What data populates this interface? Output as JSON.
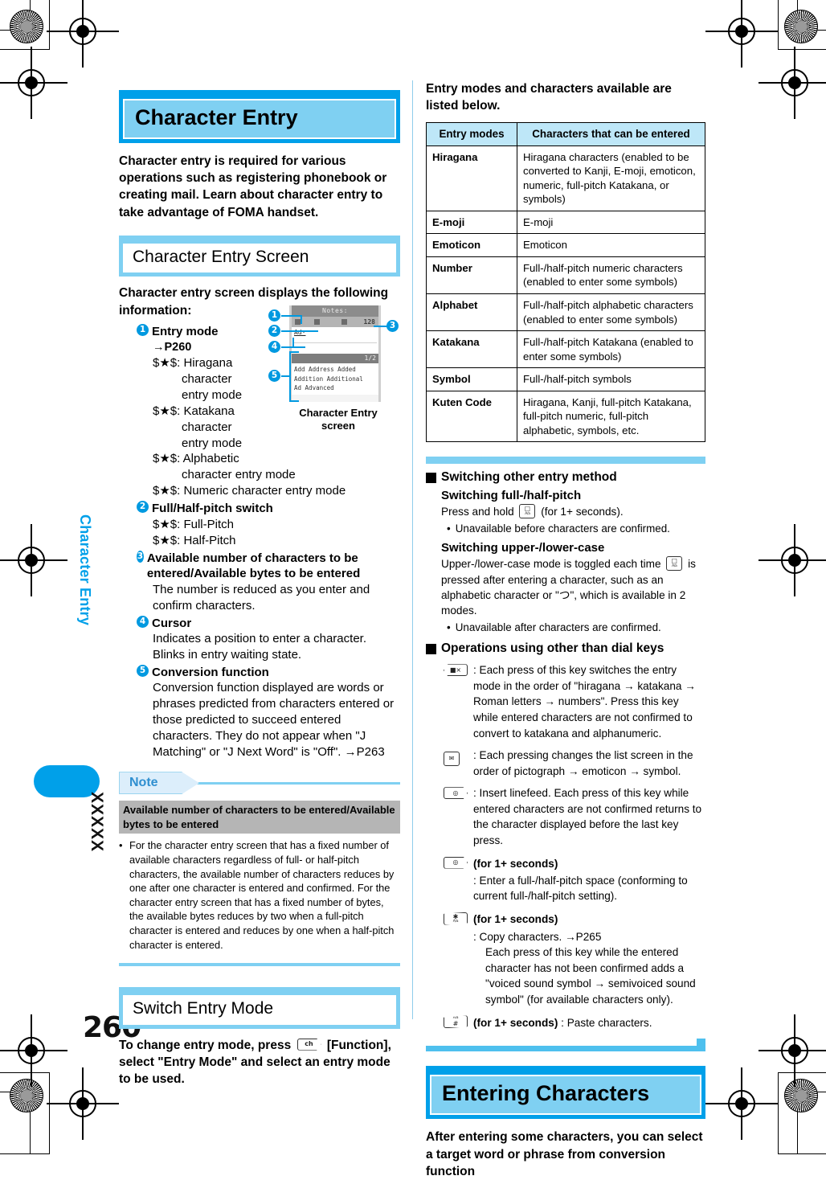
{
  "page": {
    "number": "260",
    "sidebar_label": "Character Entry",
    "sidebar_code": "XXXXX"
  },
  "left": {
    "chapter_title": "Character Entry",
    "lead": "Character entry is required for various operations such as registering phonebook or creating mail. Learn about character entry to take advantage of FOMA handset.",
    "section1_title": "Character Entry Screen",
    "section1_intro": "Character entry screen displays the following information:",
    "items": [
      {
        "num": "1",
        "title": "Entry mode",
        "ref": "→P260",
        "lines": [
          "$★$: Hiragana",
          "character",
          "entry mode",
          "$★$: Katakana",
          "character",
          "entry mode",
          "$★$: Alphabetic",
          "character entry mode",
          "$★$: Numeric character entry mode"
        ]
      },
      {
        "num": "2",
        "title": "Full/Half-pitch switch",
        "lines": [
          "$★$: Full-Pitch",
          "$★$: Half-Pitch"
        ]
      },
      {
        "num": "3",
        "title": "Available number of characters to be entered/Available bytes to be entered",
        "body": "The number is reduced as you enter and confirm characters."
      },
      {
        "num": "4",
        "title": "Cursor",
        "body": "Indicates a position to enter a character. Blinks in entry waiting state."
      },
      {
        "num": "5",
        "title": "Conversion function",
        "body": "Conversion function displayed are words or phrases predicted from characters entered or those predicted to succeed entered characters. They do not appear when \"J Matching\" or \"J Next Word\" is \"Off\". →P263"
      }
    ],
    "figure": {
      "caption_line1": "Character Entry",
      "caption_line2": "screen",
      "screen_title": "Notes:",
      "byte_count": "128",
      "edit_text": "Ad·",
      "conv_page": "1/2",
      "conv_words": [
        "Add  Address  Added",
        "Addition  Additional",
        "Ad   Advanced"
      ],
      "callouts": [
        "1",
        "2",
        "3",
        "4",
        "5"
      ]
    },
    "note": {
      "tag": "Note",
      "subhead": "Available number of characters to be entered/Available bytes to be entered",
      "bullet": "For the character entry screen that has a fixed number of available characters regardless of full- or half-pitch characters, the available number of characters reduces by one after one character is entered and confirmed. For the character entry screen that has a fixed number of bytes, the available bytes reduces by two when a full-pitch character is entered and reduces by one when a half-pitch character is entered."
    },
    "section2_title": "Switch Entry Mode",
    "section2_body_a": "To change entry mode, press",
    "section2_body_b": "[Function], select \"Entry Mode\" and select an entry mode to be used."
  },
  "right": {
    "intro": "Entry modes and characters available are listed below.",
    "table": {
      "headers": [
        "Entry modes",
        "Characters that can be entered"
      ],
      "rows": [
        [
          "Hiragana",
          "Hiragana characters (enabled to be converted to Kanji, E-moji, emoticon, numeric, full-pitch Katakana, or symbols)"
        ],
        [
          "E-moji",
          "E-moji"
        ],
        [
          "Emoticon",
          "Emoticon"
        ],
        [
          "Number",
          "Full-/half-pitch numeric characters (enabled to enter some symbols)"
        ],
        [
          "Alphabet",
          "Full-/half-pitch alphabetic characters (enabled to enter some symbols)"
        ],
        [
          "Katakana",
          "Full-/half-pitch Katakana (enabled to enter some symbols)"
        ],
        [
          "Symbol",
          "Full-/half-pitch symbols"
        ],
        [
          "Kuten Code",
          "Hiragana, Kanji, full-pitch Katakana, full-pitch numeric, full-pitch alphabetic, symbols, etc."
        ]
      ]
    },
    "switching": {
      "heading": "Switching other entry method",
      "sub1_head": "Switching full-/half-pitch",
      "sub1_a": "Press and hold",
      "sub1_b": "(for 1+ seconds).",
      "sub1_bullet": "Unavailable before characters are confirmed.",
      "sub2_head": "Switching upper-/lower-case",
      "sub2_a": "Upper-/lower-case mode is toggled each time",
      "sub2_b": "is pressed after entering a character, such as an alphabetic character or \"つ\", which is available in 2 modes.",
      "sub2_bullet": "Unavailable after characters are confirmed."
    },
    "operations": {
      "heading": "Operations using other than dial keys",
      "rows": [
        {
          "key": "mode-switch-key",
          "text": ": Each press of this key switches the entry mode in the order of \"hiragana → katakana → Roman letters → numbers\". Press this key while entered characters are not confirmed to convert to katakana and alphanumeric."
        },
        {
          "key": "mail-key",
          "text": ": Each pressing changes the list screen in the order of pictograph → emoticon → symbol."
        },
        {
          "key": "clear-key",
          "text": ": Insert linefeed. Each press of this key while entered characters are not confirmed returns to the character displayed before the last key press."
        },
        {
          "key": "clear-key-hold",
          "bold": "(for 1+ seconds)",
          "text": ": Enter a full-/half-pitch space (conforming to current full-/half-pitch setting)."
        },
        {
          "key": "star-key-hold",
          "bold": "(for 1+ seconds)",
          "text": ": Copy characters. →P265",
          "text2": "Each press of this key while the entered character has not been confirmed adds a \"voiced sound symbol → semivoiced sound symbol\" (for available characters only)."
        },
        {
          "key": "hash-key-hold",
          "bold": "(for 1+ seconds)",
          "text": ": Paste characters."
        }
      ]
    },
    "chapter2_title": "Entering Characters",
    "chapter2_lead": "After entering some characters, you can select a target word or phrase from conversion function"
  }
}
